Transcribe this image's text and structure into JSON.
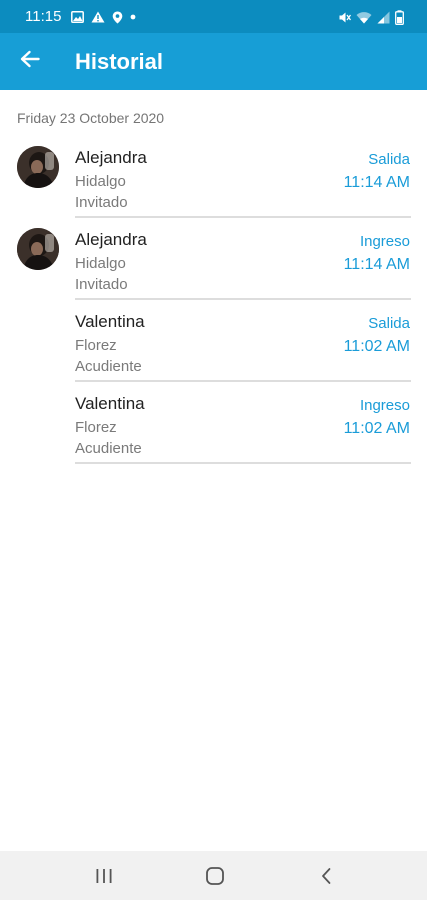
{
  "status_bar": {
    "time": "11:15",
    "left_icons": [
      "image-icon",
      "warning-icon",
      "location-icon",
      "dot-icon"
    ],
    "right_icons": [
      "mute-icon",
      "wifi-icon",
      "signal-icon",
      "battery-icon"
    ]
  },
  "app_bar": {
    "title": "Historial",
    "back_icon": "arrow-left-icon"
  },
  "date_header": "Friday 23 October 2020",
  "entries": [
    {
      "name": "Alejandra",
      "surname": "Hidalgo",
      "role": "Invitado",
      "type": "Salida",
      "time": "11:14 AM",
      "has_avatar": true
    },
    {
      "name": "Alejandra",
      "surname": "Hidalgo",
      "role": "Invitado",
      "type": "Ingreso",
      "time": "11:14 AM",
      "has_avatar": true
    },
    {
      "name": "Valentina",
      "surname": "Florez",
      "role": "Acudiente",
      "type": "Salida",
      "time": "11:02 AM",
      "has_avatar": false
    },
    {
      "name": "Valentina",
      "surname": "Florez",
      "role": "Acudiente",
      "type": "Ingreso",
      "time": "11:02 AM",
      "has_avatar": false
    }
  ],
  "nav_bar": {
    "buttons": [
      "recent-apps-icon",
      "home-icon",
      "back-icon"
    ]
  },
  "colors": {
    "status_bar": "#0C8CBF",
    "app_bar": "#179ED6",
    "accent": "#1A9CD8",
    "secondary_text": "#7a7a7a",
    "divider": "#dddddd",
    "nav_bar": "#f1f1f1"
  }
}
